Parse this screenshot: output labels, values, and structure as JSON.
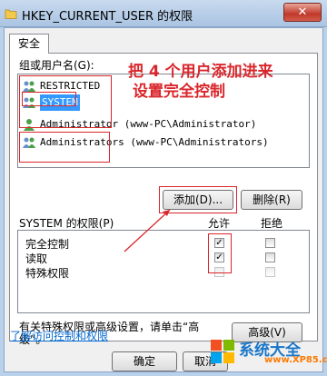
{
  "window": {
    "title": "HKEY_CURRENT_USER 的权限",
    "close_glyph": "✕"
  },
  "tab": {
    "label": "安全"
  },
  "groups": {
    "label": "组或用户名(G):",
    "items": [
      {
        "name": "RESTRICTED",
        "detail": "",
        "icon": "user-group-icon",
        "selected": false
      },
      {
        "name": "SYSTEM",
        "detail": "",
        "icon": "user-group-icon",
        "selected": true
      },
      {
        "name": "Administrator",
        "detail": "(www-PC\\Administrator)",
        "icon": "user-icon",
        "selected": false
      },
      {
        "name": "Administrators",
        "detail": "(www-PC\\Administrators)",
        "icon": "user-group-icon",
        "selected": false
      }
    ]
  },
  "annotation": {
    "line1": "把 4 个用户添加进来",
    "line2": "设置完全控制",
    "color": "#d9262b"
  },
  "buttons": {
    "add": "添加(D)...",
    "remove": "删除(R)",
    "advanced": "高级(V)",
    "ok": "确定",
    "cancel": "取消"
  },
  "permissions": {
    "label": "SYSTEM 的权限(P)",
    "allow_header": "允许",
    "deny_header": "拒绝",
    "rows": [
      {
        "name": "完全控制",
        "allow": true,
        "deny": false,
        "disabled": false
      },
      {
        "name": "读取",
        "allow": true,
        "deny": false,
        "disabled": false
      },
      {
        "name": "特殊权限",
        "allow": false,
        "deny": false,
        "disabled": true
      }
    ]
  },
  "advanced_hint": "有关特殊权限或高级设置，请单击“高级”。",
  "advanced_hint_line1": "有关特殊权限或高级设置，请单击“高",
  "advanced_hint_line2": "级”。",
  "help_link": "了解访问控制和权限",
  "watermark": {
    "text": "系统大全",
    "url": "www.XP85.com",
    "colors": [
      "#f25022",
      "#7fba00",
      "#00a4ef",
      "#ffb900"
    ]
  }
}
